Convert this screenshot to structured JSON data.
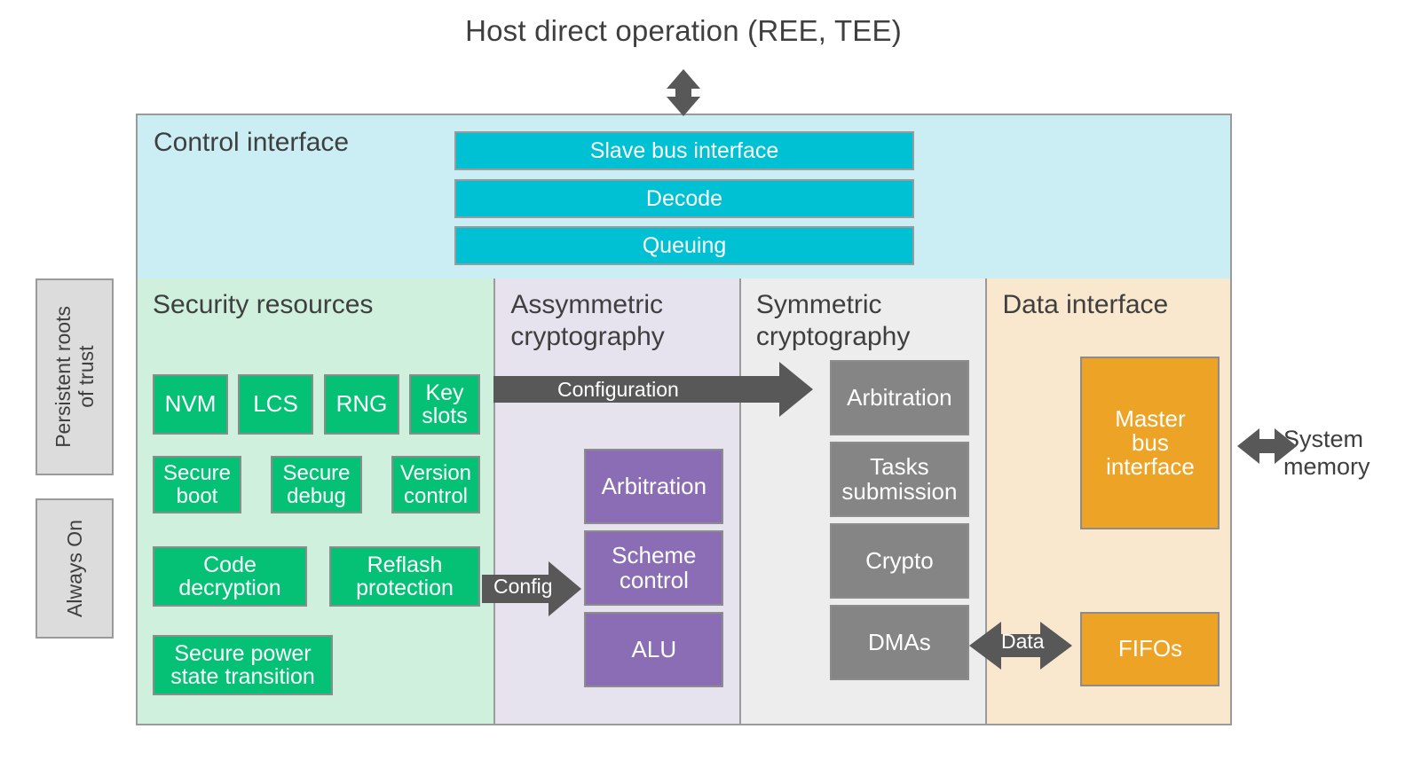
{
  "caption": {
    "host": "Host direct operation (REE, TEE)",
    "system_memory": "System\nmemory"
  },
  "side_labels": {
    "persistent_roots": "Persistent roots\nof trust",
    "always_on": "Always On"
  },
  "control_interface": {
    "title": "Control interface",
    "blocks": [
      {
        "label": "Slave bus interface"
      },
      {
        "label": "Decode"
      },
      {
        "label": "Queuing"
      }
    ]
  },
  "columns": [
    {
      "id": "security",
      "title": "Security resources",
      "bg": "#CEF0DD",
      "block_color": "#05C175",
      "blocks": [
        {
          "label": "NVM"
        },
        {
          "label": "LCS"
        },
        {
          "label": "RNG"
        },
        {
          "label": "Key\nslots"
        },
        {
          "label": "Secure\nboot"
        },
        {
          "label": "Secure\ndebug"
        },
        {
          "label": "Version\ncontrol"
        },
        {
          "label": "Code\ndecryption"
        },
        {
          "label": "Reflash\nprotection"
        },
        {
          "label": "Secure power\nstate transition"
        }
      ]
    },
    {
      "id": "asymmetric",
      "title": "Assymmetric\ncryptography",
      "bg": "#E6E2EE",
      "block_color": "#8A6DB5",
      "blocks": [
        {
          "label": "Arbitration"
        },
        {
          "label": "Scheme\ncontrol"
        },
        {
          "label": "ALU"
        }
      ]
    },
    {
      "id": "symmetric",
      "title": "Symmetric\ncryptography",
      "bg": "#EDEDED",
      "block_color": "#858585",
      "blocks": [
        {
          "label": "Arbitration"
        },
        {
          "label": "Tasks\nsubmission"
        },
        {
          "label": "Crypto"
        },
        {
          "label": "DMAs"
        }
      ]
    },
    {
      "id": "data",
      "title": "Data interface",
      "bg": "#FAE8CE",
      "block_color": "#EDA326",
      "blocks": [
        {
          "label": "Master\nbus\ninterface"
        },
        {
          "label": "FIFOs"
        }
      ]
    }
  ],
  "arrows": [
    {
      "name": "host-link",
      "label": "",
      "direction": "bidirectional"
    },
    {
      "name": "configuration",
      "label": "Configuration",
      "direction": "right"
    },
    {
      "name": "config",
      "label": "Config",
      "direction": "right"
    },
    {
      "name": "data-link",
      "label": "Data",
      "direction": "bidirectional"
    },
    {
      "name": "system-memory-link",
      "label": "",
      "direction": "bidirectional"
    }
  ],
  "colors": {
    "cyan": "#00C1D4",
    "green": "#05C175",
    "purple": "#8A6DB5",
    "gray": "#858585",
    "orange": "#EDA326",
    "arrow": "#585858",
    "border": "#9a9a9a",
    "control_bg": "#CBEEF5"
  }
}
